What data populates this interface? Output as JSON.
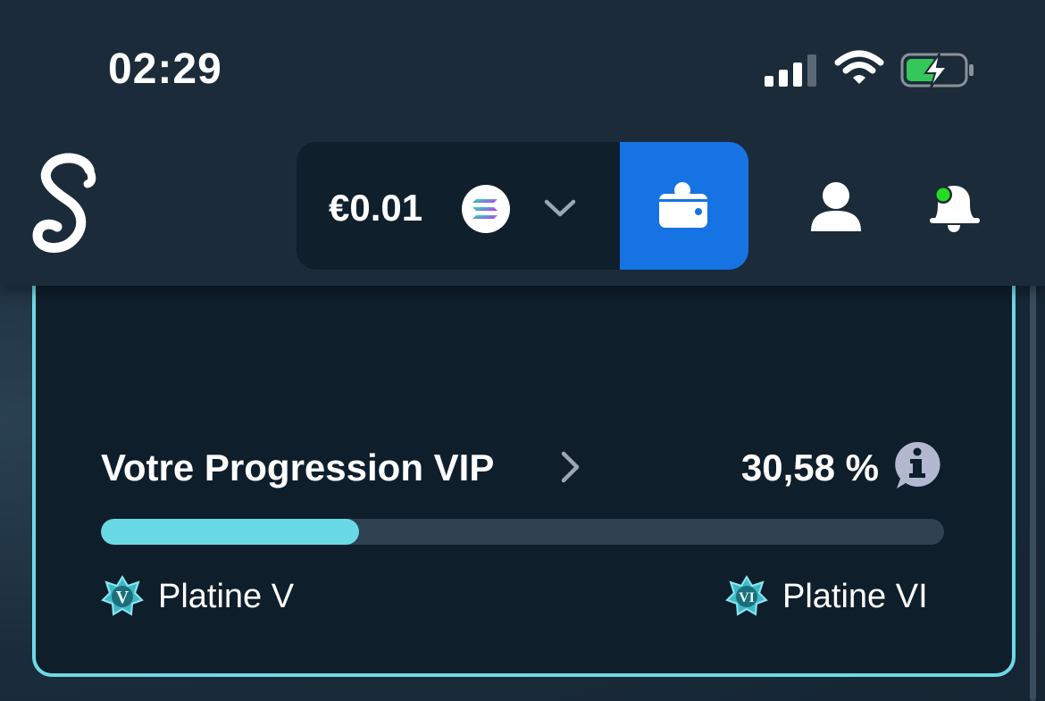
{
  "status_bar": {
    "time": "02:29",
    "icons": [
      "signal-icon",
      "wifi-icon",
      "battery-charging-icon"
    ]
  },
  "header": {
    "logo_letter": "S",
    "balance": {
      "amount": "€0.01",
      "currency_icon": "solana-coin-icon"
    },
    "wallet_icon": "wallet-icon",
    "profile_icon": "user-icon",
    "notification_icon": "bell-icon"
  },
  "vip": {
    "title": "Votre Progression VIP",
    "percent_text": "30,58 %",
    "progress": 0.3058,
    "current_tier": {
      "label": "Platine V",
      "badge": "V"
    },
    "next_tier": {
      "label": "Platine VI",
      "badge": "VI"
    }
  },
  "colors": {
    "accent": "#6dd9e6",
    "wallet_button": "#1673e3",
    "notification_dot": "#22dd22",
    "battery_fill": "#34c759"
  }
}
